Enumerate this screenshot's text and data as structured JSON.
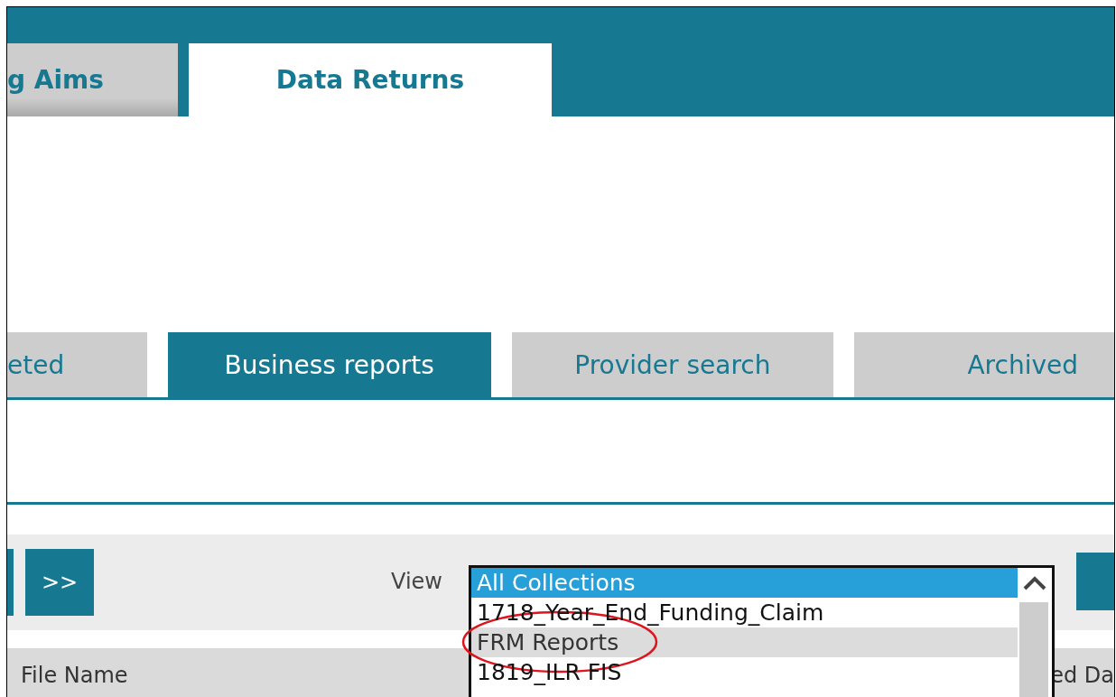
{
  "main_tabs": [
    {
      "label": "g Aims",
      "selected": false
    },
    {
      "label": "Data Returns",
      "selected": true
    }
  ],
  "sub_tabs": [
    {
      "label": "eted",
      "selected": false
    },
    {
      "label": "Business reports",
      "selected": true
    },
    {
      "label": "Provider search",
      "selected": false
    },
    {
      "label": "Archived",
      "selected": false
    }
  ],
  "toolbar": {
    "next_label": ">>",
    "view_label": "View"
  },
  "view_list": {
    "options": [
      {
        "label": "All Collections",
        "selected": true,
        "hovered": false,
        "circled": false
      },
      {
        "label": "1718_Year_End_Funding_Claim",
        "selected": false,
        "hovered": false,
        "circled": false
      },
      {
        "label": "FRM Reports",
        "selected": false,
        "hovered": true,
        "circled": true
      },
      {
        "label": "1819_ILR FIS",
        "selected": false,
        "hovered": false,
        "circled": false
      }
    ]
  },
  "table": {
    "columns": [
      "File Name",
      "ed Da"
    ]
  }
}
